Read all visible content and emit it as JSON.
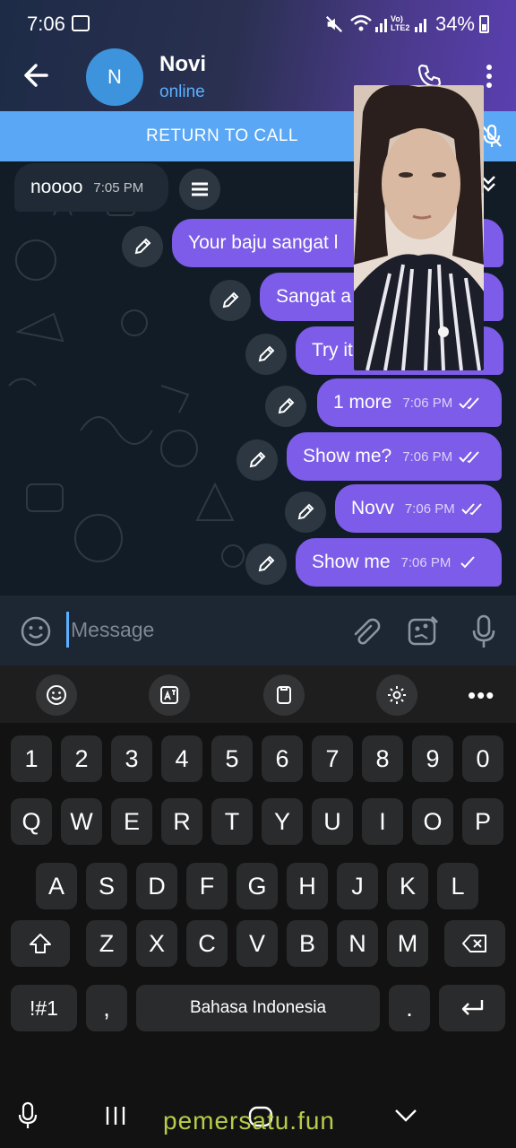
{
  "status_bar": {
    "time": "7:06",
    "network": "Vo) LTE2",
    "battery": "34%"
  },
  "chat_header": {
    "avatar_letter": "N",
    "name": "Novi",
    "status": "online"
  },
  "call_banner": {
    "label": "RETURN TO CALL"
  },
  "messages": [
    {
      "text": "noooo",
      "time": "7:05 PM",
      "direction": "in"
    },
    {
      "text": "Your baju sangat l",
      "time": "",
      "direction": "out",
      "status": "read"
    },
    {
      "text": "Sangat a",
      "time": "",
      "direction": "out",
      "status": "read"
    },
    {
      "text": "Try it",
      "time": "",
      "direction": "out",
      "status": "read"
    },
    {
      "text": "1 more",
      "time": "7:06 PM",
      "direction": "out",
      "status": "read"
    },
    {
      "text": "Show me?",
      "time": "7:06 PM",
      "direction": "out",
      "status": "read"
    },
    {
      "text": "Novv",
      "time": "7:06 PM",
      "direction": "out",
      "status": "read"
    },
    {
      "text": "Show me",
      "time": "7:06 PM",
      "direction": "out",
      "status": "sent"
    }
  ],
  "composer": {
    "placeholder": "Message",
    "value": ""
  },
  "keyboard": {
    "number_row": [
      "1",
      "2",
      "3",
      "4",
      "5",
      "6",
      "7",
      "8",
      "9",
      "0"
    ],
    "row1": [
      "Q",
      "W",
      "E",
      "R",
      "T",
      "Y",
      "U",
      "I",
      "O",
      "P"
    ],
    "row2": [
      "A",
      "S",
      "D",
      "F",
      "G",
      "H",
      "J",
      "K",
      "L"
    ],
    "row3": [
      "Z",
      "X",
      "C",
      "V",
      "B",
      "N",
      "M"
    ],
    "symbols_key": "!#1",
    "comma_key": ",",
    "space_label": "Bahasa Indonesia",
    "period_key": ".",
    "more_label": "•••"
  },
  "watermark": "pemersatu.fun",
  "colors": {
    "accent": "#5ab0ff",
    "outgoing_bubble": "#7c5ce8",
    "call_bar": "#5aa7f5"
  }
}
